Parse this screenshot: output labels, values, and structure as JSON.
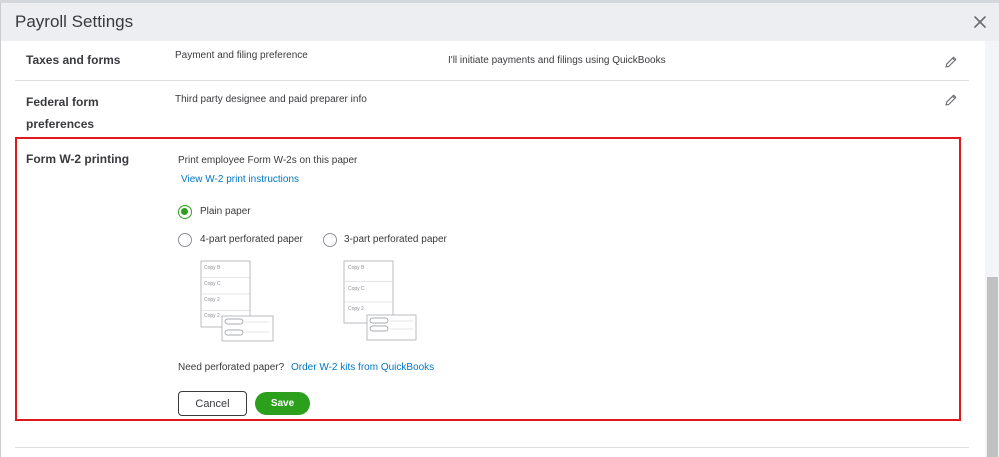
{
  "dialog": {
    "title": "Payroll Settings",
    "close_icon": "close-icon"
  },
  "rows": {
    "taxes": {
      "label": "Taxes and forms",
      "description": "Payment and filing preference",
      "value": "I'll initiate payments and filings using QuickBooks",
      "edit_icon": "pencil-icon"
    },
    "federal": {
      "label_line1": "Federal form",
      "label_line2": "preferences",
      "description": "Third party designee and paid preparer info",
      "edit_icon": "pencil-icon"
    },
    "w2": {
      "label": "Form W-2 printing",
      "description": "Print employee Form W-2s on this paper",
      "instructions_link": "View W-2 print instructions",
      "options": {
        "plain": {
          "label": "Plain paper",
          "selected": true
        },
        "four_part": {
          "label": "4-part perforated paper",
          "selected": false
        },
        "three_part": {
          "label": "3-part perforated paper",
          "selected": false
        }
      },
      "four_part_copies": [
        "Copy B",
        "Copy C",
        "Copy 2",
        "Copy 2"
      ],
      "three_part_copies": [
        "Copy B",
        "Copy C",
        "Copy 2"
      ],
      "need_paper_text": "Need perforated paper?",
      "order_link": "Order W-2 kits from QuickBooks"
    }
  },
  "actions": {
    "cancel_label": "Cancel",
    "save_label": "Save"
  },
  "colors": {
    "accent_green": "#2ca01c",
    "link_blue": "#0077c5",
    "highlight_red": "#e01a1a"
  }
}
